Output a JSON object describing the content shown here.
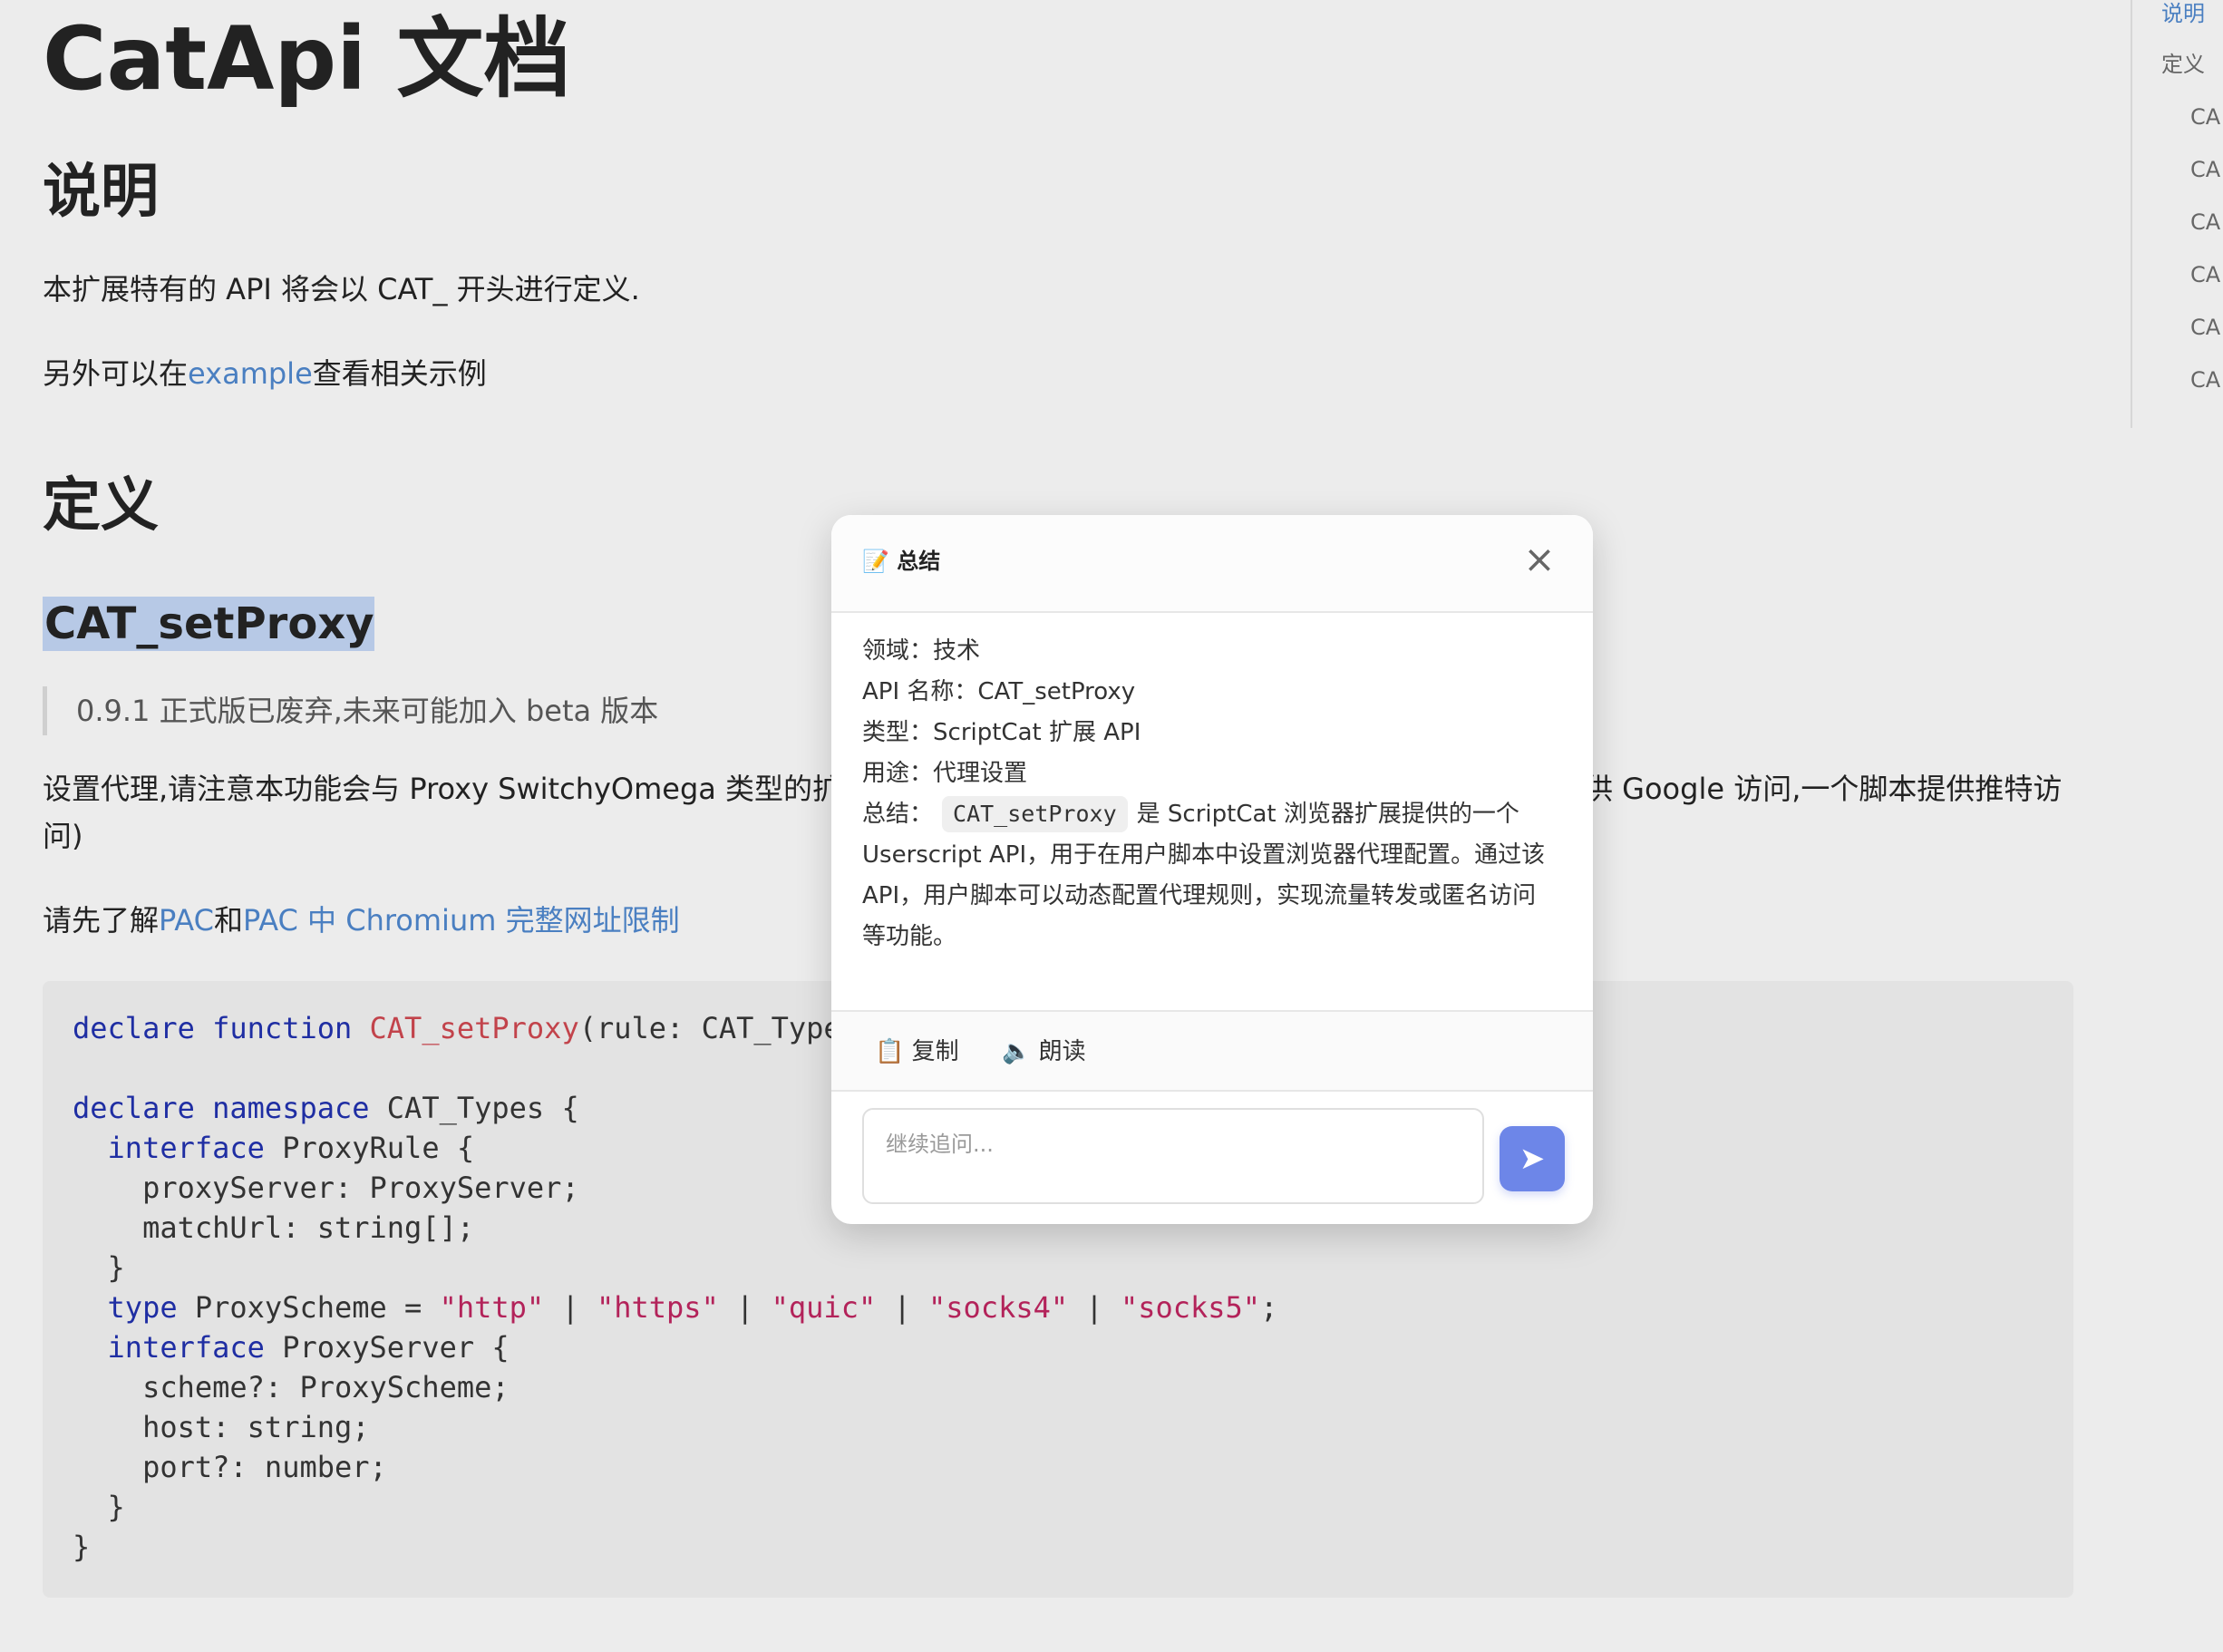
{
  "page": {
    "title": "CatApi 文档",
    "sections": {
      "explanation": {
        "heading": "说明",
        "line1": "本扩展特有的 API 将会以 CAT_ 开头进行定义.",
        "line2_prefix": "另外可以在",
        "line2_link": "example",
        "line2_suffix": "查看相关示例"
      },
      "definition": {
        "heading": "定义"
      }
    },
    "api": {
      "title": "CAT_setProxy",
      "quote": "0.9.1 正式版已废弃,未来可能加入 beta 版本",
      "desc_left": "设置代理,请注意本功能会与 Proxy SwitchyOmega 类型的扩展",
      "desc_right": "供 Google 访问,一个脚本提供推特访",
      "desc_second_line": "问)",
      "pac_prefix": "请先了解",
      "pac_link1": "PAC",
      "pac_and": "和",
      "pac_link2": "PAC 中 Chromium 完整网址限制"
    },
    "code": {
      "lines": [
        {
          "parts": [
            {
              "t": "declare",
              "c": "kw"
            },
            {
              "t": " "
            },
            {
              "t": "function",
              "c": "kw"
            },
            {
              "t": " "
            },
            {
              "t": "CAT_setProxy",
              "c": "fn"
            },
            {
              "t": "(rule: CAT_Types."
            }
          ]
        },
        {
          "parts": [
            {
              "t": ""
            }
          ]
        },
        {
          "parts": [
            {
              "t": "declare",
              "c": "kw"
            },
            {
              "t": " "
            },
            {
              "t": "namespace",
              "c": "kw"
            },
            {
              "t": " CAT_Types {"
            }
          ]
        },
        {
          "parts": [
            {
              "t": "  "
            },
            {
              "t": "interface",
              "c": "kw"
            },
            {
              "t": " ProxyRule {"
            }
          ]
        },
        {
          "parts": [
            {
              "t": "    proxyServer: ProxyServer;"
            }
          ]
        },
        {
          "parts": [
            {
              "t": "    matchUrl: string[];"
            }
          ]
        },
        {
          "parts": [
            {
              "t": "  }"
            }
          ]
        },
        {
          "parts": [
            {
              "t": "  "
            },
            {
              "t": "type",
              "c": "kw"
            },
            {
              "t": " ProxyScheme = "
            },
            {
              "t": "\"http\"",
              "c": "str"
            },
            {
              "t": " | "
            },
            {
              "t": "\"https\"",
              "c": "str"
            },
            {
              "t": " | "
            },
            {
              "t": "\"quic\"",
              "c": "str"
            },
            {
              "t": " | "
            },
            {
              "t": "\"socks4\"",
              "c": "str"
            },
            {
              "t": " | "
            },
            {
              "t": "\"socks5\"",
              "c": "str"
            },
            {
              "t": ";"
            }
          ]
        },
        {
          "parts": [
            {
              "t": "  "
            },
            {
              "t": "interface",
              "c": "kw"
            },
            {
              "t": " ProxyServer {"
            }
          ]
        },
        {
          "parts": [
            {
              "t": "    scheme?: ProxyScheme;"
            }
          ]
        },
        {
          "parts": [
            {
              "t": "    host: string;"
            }
          ]
        },
        {
          "parts": [
            {
              "t": "    port?: number;"
            }
          ]
        },
        {
          "parts": [
            {
              "t": "  }"
            }
          ]
        },
        {
          "parts": [
            {
              "t": "}"
            }
          ]
        }
      ]
    }
  },
  "toc": {
    "items": [
      {
        "label": "说明",
        "active": true,
        "child": false
      },
      {
        "label": "定义",
        "active": false,
        "child": false
      },
      {
        "label": "CA",
        "active": false,
        "child": true
      },
      {
        "label": "CA",
        "active": false,
        "child": true
      },
      {
        "label": "CA",
        "active": false,
        "child": true
      },
      {
        "label": "CA",
        "active": false,
        "child": true
      },
      {
        "label": "CA",
        "active": false,
        "child": true
      },
      {
        "label": "CA",
        "active": false,
        "child": true
      }
    ]
  },
  "modal": {
    "icon": "📝",
    "title": "总结",
    "close_label": "×",
    "summary": {
      "domain_label": "领域：",
      "domain_value": "技术",
      "api_name_label": "API 名称：",
      "api_name_value": "CAT_setProxy",
      "type_label": "类型：",
      "type_value": "ScriptCat 扩展 API",
      "usage_label": "用途：",
      "usage_value": "代理设置",
      "summary_label": "总结：",
      "summary_code": "CAT_setProxy",
      "summary_line1": "是 ScriptCat 浏览器扩展提供的一个",
      "summary_line2": "Userscript API，用于在用户脚本中设置浏览器代理配置。通过该",
      "summary_line3": "API，用户脚本可以动态配置代理规则，实现流量转发或匿名访问",
      "summary_line4": "等功能。"
    },
    "actions": {
      "copy_icon": "📋",
      "copy_label": "复制",
      "read_icon": "🔈",
      "read_label": "朗读"
    },
    "input": {
      "placeholder": "继续追问...",
      "value": ""
    },
    "send_icon": "➤",
    "colors": {
      "send_button": "#6d86e8"
    }
  },
  "colors": {
    "page_background": "#ececec",
    "link": "#4a7fc1",
    "highlight": "#b7c9e6",
    "code_background": "#e3e3e3",
    "keyword": "#1f2ea3",
    "function": "#c2434b",
    "string": "#b3235a"
  }
}
